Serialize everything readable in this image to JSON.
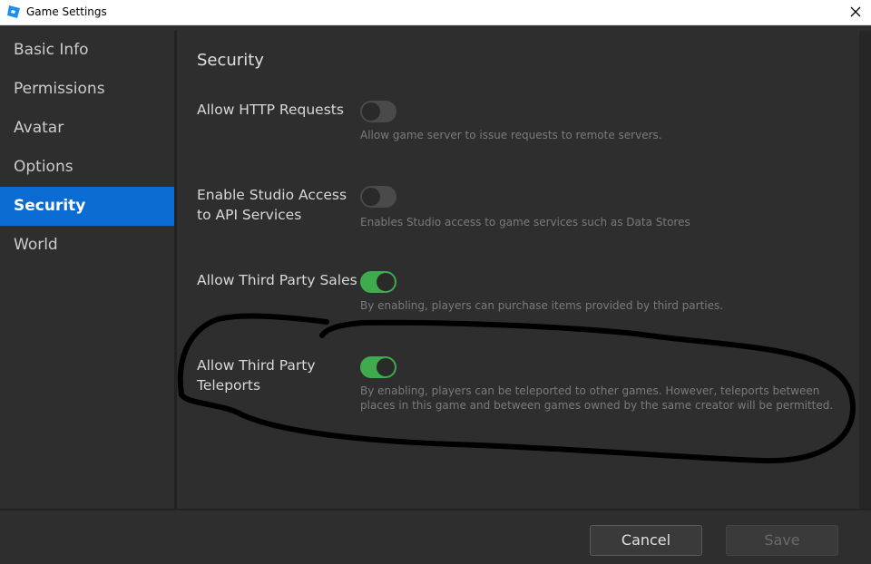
{
  "window": {
    "title": "Game Settings"
  },
  "icons": {
    "app": "roblox-studio-logo-icon",
    "close": "close-icon"
  },
  "sidebar": {
    "items": [
      {
        "label": "Basic Info",
        "active": false
      },
      {
        "label": "Permissions",
        "active": false
      },
      {
        "label": "Avatar",
        "active": false
      },
      {
        "label": "Options",
        "active": false
      },
      {
        "label": "Security",
        "active": true
      },
      {
        "label": "World",
        "active": false
      }
    ]
  },
  "main": {
    "section_title": "Security",
    "settings": [
      {
        "label": "Allow HTTP Requests",
        "enabled": false,
        "description": "Allow game server to issue requests to remote servers."
      },
      {
        "label": "Enable Studio Access to API Services",
        "enabled": false,
        "description": "Enables Studio access to game services such as Data Stores"
      },
      {
        "label": "Allow Third Party Sales",
        "enabled": true,
        "description": "By enabling, players can purchase items provided by third parties."
      },
      {
        "label": "Allow Third Party Teleports",
        "enabled": true,
        "description": "By enabling, players can be teleported to other games. However, teleports between places in this game and between games owned by the same creator will be permitted."
      }
    ]
  },
  "footer": {
    "cancel_label": "Cancel",
    "save_label": "Save"
  },
  "colors": {
    "accent": "#0a6bd3",
    "toggle_on": "#3dab4e",
    "toggle_off": "#4a4a4a",
    "background": "#2e2e2e",
    "annotation": "#000000"
  }
}
